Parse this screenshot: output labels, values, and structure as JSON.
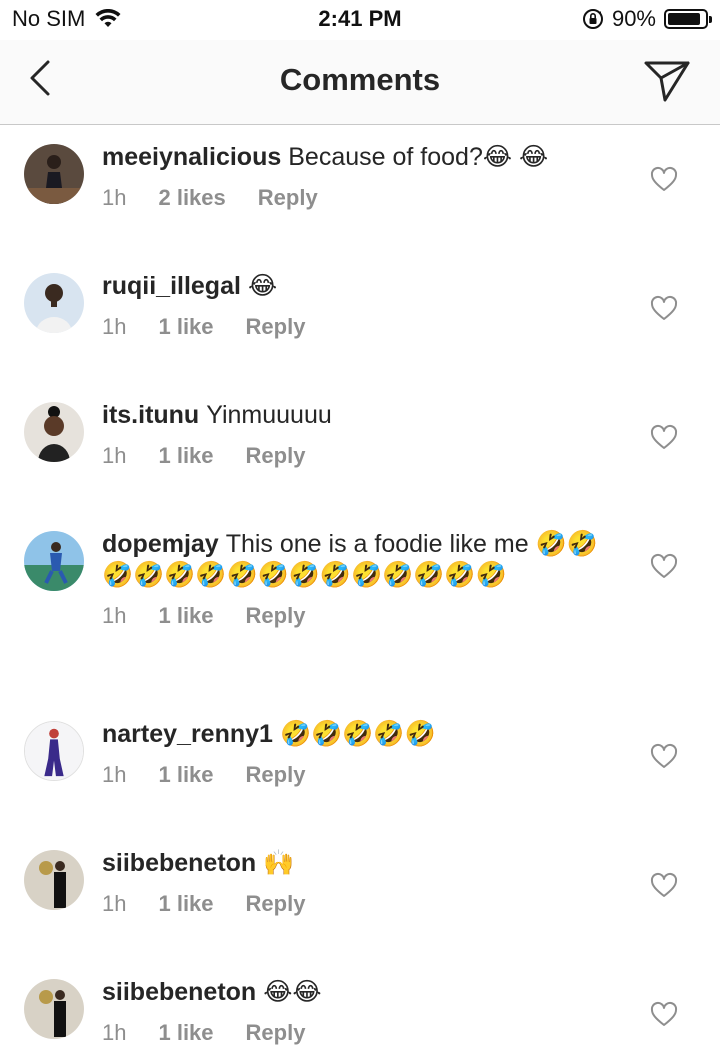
{
  "status_bar": {
    "carrier": "No SIM",
    "time": "2:41 PM",
    "battery": "90%",
    "battery_level": 0.9
  },
  "nav": {
    "title": "Comments",
    "back_icon": "chevron-left-icon",
    "send_icon": "paper-plane-icon"
  },
  "comments": [
    {
      "username": "meeiynalicious",
      "text": "Because of food?😂 😂",
      "time": "1h",
      "likes": "2 likes",
      "reply": "Reply"
    },
    {
      "username": "ruqii_illegal",
      "text": "😂",
      "time": "1h",
      "likes": "1 like",
      "reply": "Reply"
    },
    {
      "username": "its.itunu",
      "text": "Yinmuuuuu",
      "time": "1h",
      "likes": "1 like",
      "reply": "Reply"
    },
    {
      "username": "dopemjay",
      "text": "This one is a foodie like me 🤣🤣🤣🤣🤣🤣🤣🤣🤣🤣🤣🤣🤣🤣🤣",
      "time": "1h",
      "likes": "1 like",
      "reply": "Reply"
    },
    {
      "username": "nartey_renny1",
      "text": "🤣🤣🤣🤣🤣",
      "time": "1h",
      "likes": "1 like",
      "reply": "Reply"
    },
    {
      "username": "siibebeneton",
      "text": "🙌",
      "time": "1h",
      "likes": "1 like",
      "reply": "Reply"
    },
    {
      "username": "siibebeneton",
      "text": "😂😂",
      "time": "1h",
      "likes": "1 like",
      "reply": "Reply"
    }
  ],
  "colors": {
    "text": "#262626",
    "meta": "#8e8e8e",
    "divider": "#c8c8c8",
    "nav_bg": "#fafafa"
  }
}
